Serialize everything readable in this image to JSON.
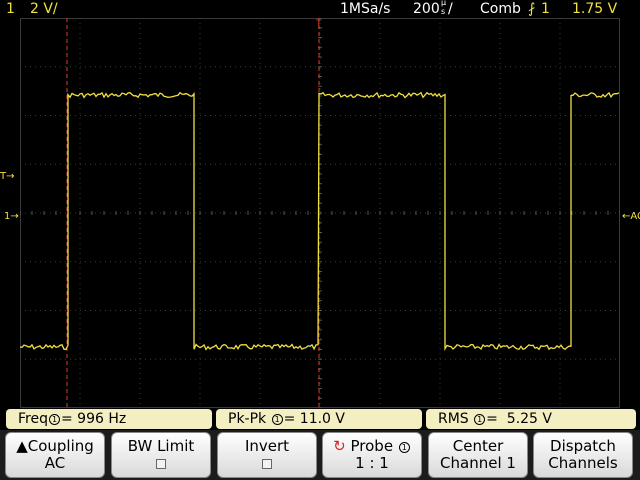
{
  "status": {
    "channel": "1",
    "volts_div": "2 V/",
    "sample_rate": "1MSa/s",
    "time_div": "200",
    "time_unit_top": "µ",
    "time_unit_bottom": "s",
    "acq_mode": "Comb",
    "trigger_source": "1",
    "trigger_level": "1.75 V"
  },
  "markers": {
    "trigger_arrow": "T",
    "channel_ground": "1",
    "right_label": "AC",
    "trigger_level_arrow": "T"
  },
  "colors": {
    "trace": "#f0e040",
    "cursor": "#e04020",
    "grid": "#3a3a3a"
  },
  "measurements": {
    "freq": {
      "label": "Freq",
      "ch": "1",
      "value": "996 Hz"
    },
    "pkpk": {
      "label": "Pk-Pk",
      "ch": "1",
      "value": "11.0 V"
    },
    "rms": {
      "label": "RMS",
      "ch": "1",
      "value": "5.25 V"
    }
  },
  "softkeys": {
    "coupling": {
      "line1": "Coupling",
      "line2": "AC"
    },
    "bwlimit": {
      "line1": "BW Limit"
    },
    "invert": {
      "line1": "Invert"
    },
    "probe": {
      "line1": "Probe",
      "ch": "1",
      "line2": "1 : 1"
    },
    "center": {
      "line1": "Center",
      "line2": "Channel 1"
    },
    "dispatch": {
      "line1": "Dispatch",
      "line2": "Channels"
    }
  }
}
